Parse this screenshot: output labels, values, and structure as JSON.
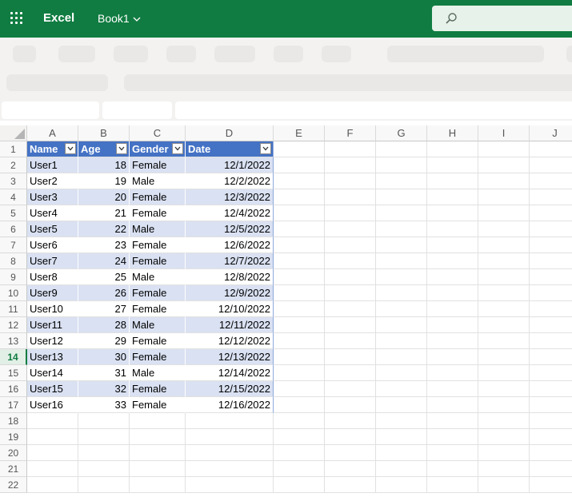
{
  "app": {
    "name": "Excel",
    "workbook": "Book1"
  },
  "icons": {
    "waffle": "waffle-icon",
    "chevron": "chevron-down-icon",
    "search": "search-icon",
    "filter": "filter-dropdown-icon"
  },
  "colors": {
    "brand": "#107c41",
    "table_header": "#4472c4",
    "table_band": "#d9e1f2"
  },
  "columns": [
    "A",
    "B",
    "C",
    "D",
    "E",
    "F",
    "G",
    "H",
    "I",
    "J"
  ],
  "rows": [
    "1",
    "2",
    "3",
    "4",
    "5",
    "6",
    "7",
    "8",
    "9",
    "10",
    "11",
    "12",
    "13",
    "14",
    "15",
    "16",
    "17",
    "18",
    "19",
    "20",
    "21",
    "22"
  ],
  "active_row": "14",
  "table": {
    "headers": [
      "Name",
      "Age",
      "Gender",
      "Date"
    ],
    "rows": [
      [
        "User1",
        "18",
        "Female",
        "12/1/2022"
      ],
      [
        "User2",
        "19",
        "Male",
        "12/2/2022"
      ],
      [
        "User3",
        "20",
        "Female",
        "12/3/2022"
      ],
      [
        "User4",
        "21",
        "Female",
        "12/4/2022"
      ],
      [
        "User5",
        "22",
        "Male",
        "12/5/2022"
      ],
      [
        "User6",
        "23",
        "Female",
        "12/6/2022"
      ],
      [
        "User7",
        "24",
        "Female",
        "12/7/2022"
      ],
      [
        "User8",
        "25",
        "Male",
        "12/8/2022"
      ],
      [
        "User9",
        "26",
        "Female",
        "12/9/2022"
      ],
      [
        "User10",
        "27",
        "Female",
        "12/10/2022"
      ],
      [
        "User11",
        "28",
        "Male",
        "12/11/2022"
      ],
      [
        "User12",
        "29",
        "Female",
        "12/12/2022"
      ],
      [
        "User13",
        "30",
        "Female",
        "12/13/2022"
      ],
      [
        "User14",
        "31",
        "Male",
        "12/14/2022"
      ],
      [
        "User15",
        "32",
        "Female",
        "12/15/2022"
      ],
      [
        "User16",
        "33",
        "Female",
        "12/16/2022"
      ]
    ]
  }
}
